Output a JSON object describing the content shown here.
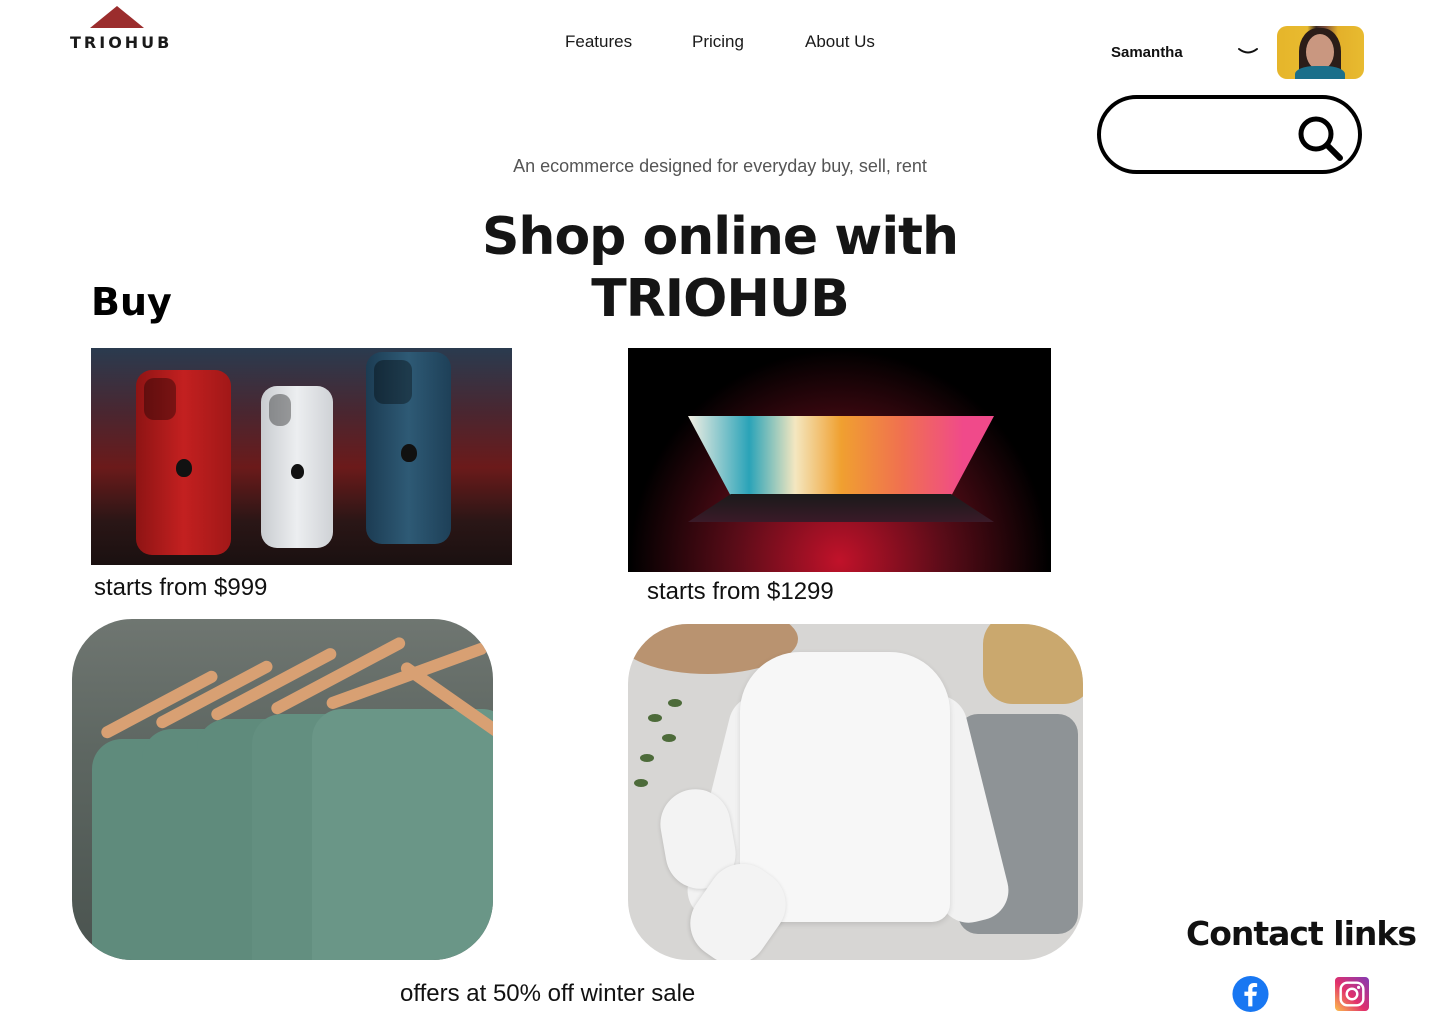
{
  "brand": {
    "name": "TRIOHUB",
    "accent": "#9b2d2d"
  },
  "nav": {
    "features": "Features",
    "pricing": "Pricing",
    "about": "About Us"
  },
  "user": {
    "name": "Samantha",
    "dropdown_icon": "chevron-down-icon"
  },
  "search": {
    "placeholder": "",
    "icon": "search-icon"
  },
  "hero": {
    "tagline": "An ecommerce designed for everyday buy, sell, rent",
    "title": "Shop online with TRIOHUB"
  },
  "buy": {
    "label": "Buy",
    "products": [
      {
        "name": "phones",
        "price": "starts from $999"
      },
      {
        "name": "laptop",
        "price": "starts from $1299"
      }
    ],
    "offer": "offers at 50% off winter sale"
  },
  "contact": {
    "title": "Contact links",
    "links": [
      {
        "name": "facebook",
        "icon": "facebook-icon",
        "color": "#1877f2"
      },
      {
        "name": "instagram",
        "icon": "instagram-icon",
        "color": "#e1306c"
      }
    ]
  }
}
